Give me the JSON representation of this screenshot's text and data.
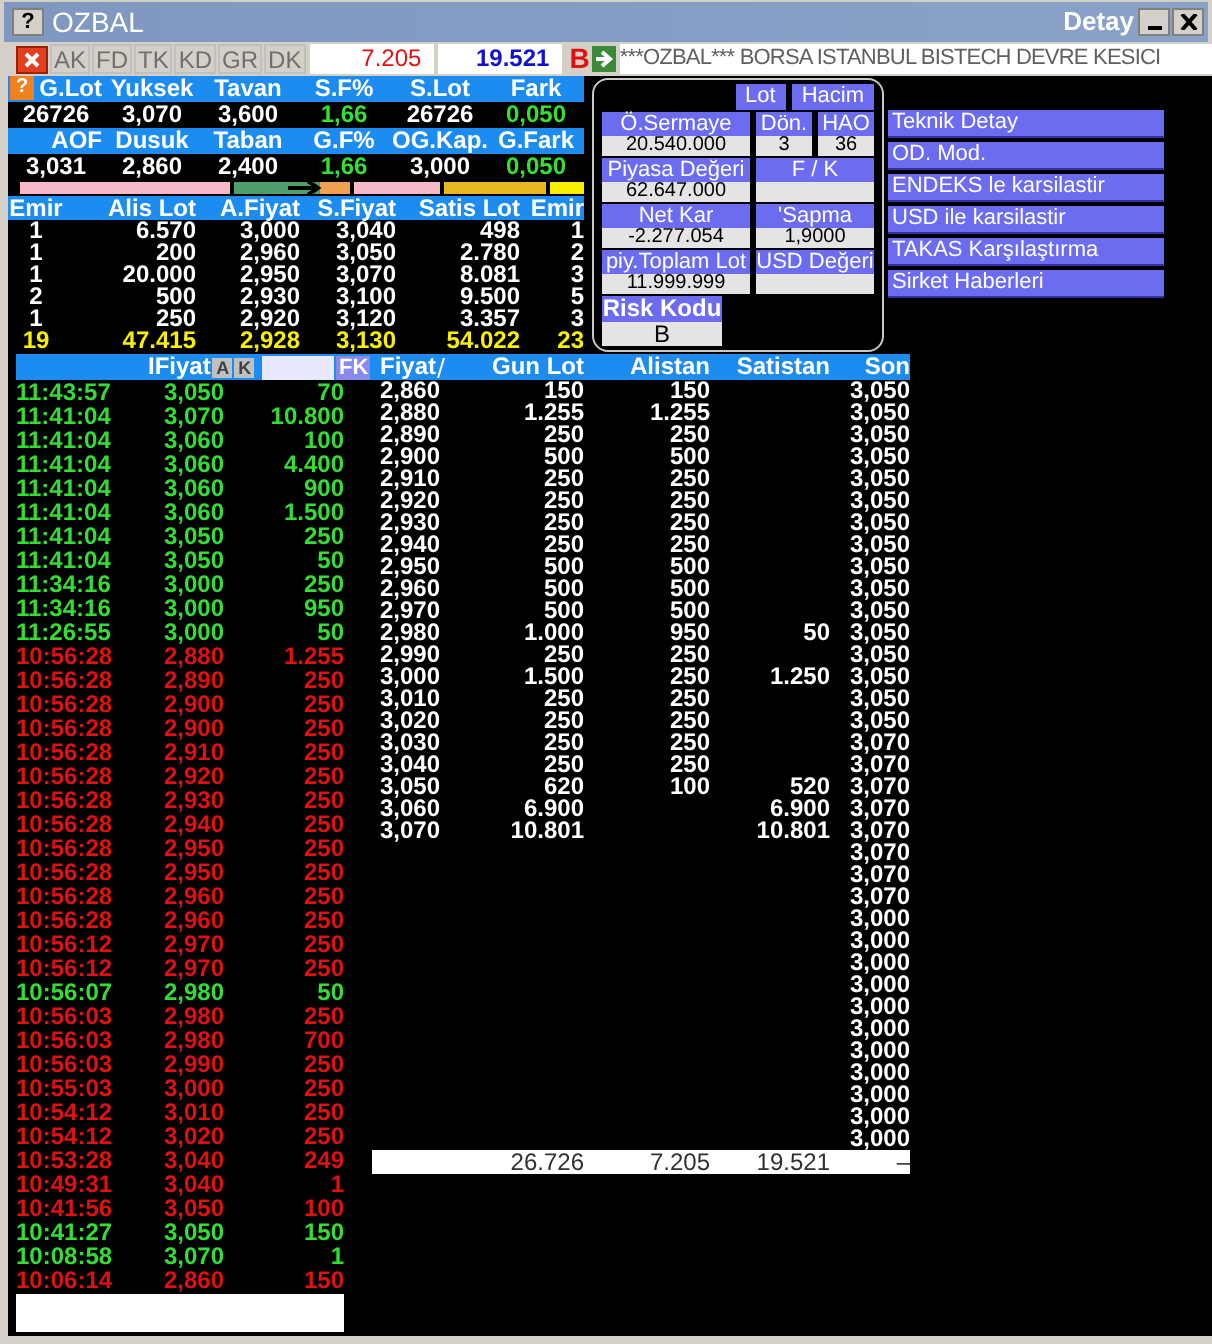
{
  "window": {
    "help": "?",
    "title": "OZBAL",
    "detail_title": "Detay"
  },
  "summary_help": "?",
  "toolbar": {
    "tabs": [
      {
        "label": "AK",
        "disabled": true
      },
      {
        "label": "FD",
        "disabled": true
      },
      {
        "label": "TK",
        "disabled": true
      },
      {
        "label": "KD",
        "disabled": true
      },
      {
        "label": "GR",
        "disabled": true
      },
      {
        "label": "DK",
        "disabled": true
      }
    ],
    "buy_total": "7.205",
    "sell_total": "19.521",
    "side_flag": "B",
    "ticker": "***OZBAL*** BORSA ISTANBUL BISTECH DEVRE KESICI"
  },
  "summary": [
    [
      {
        "label": "G.Lot",
        "value": "26726",
        "up": false
      },
      {
        "label": "Yuksek",
        "value": "3,070",
        "up": false
      },
      {
        "label": "Tavan",
        "value": "3,600",
        "up": false
      },
      {
        "label": "S.F%",
        "value": "1,66",
        "up": true
      },
      {
        "label": "S.Lot",
        "value": "26726",
        "up": false
      },
      {
        "label": "Fark",
        "value": "0,050",
        "up": true
      }
    ],
    [
      {
        "label": "AOF",
        "value": "3,031",
        "up": false
      },
      {
        "label": "Dusuk",
        "value": "2,860",
        "up": false
      },
      {
        "label": "Taban",
        "value": "2,400",
        "up": false
      },
      {
        "label": "G.F%",
        "value": "1,66",
        "up": true
      },
      {
        "label": "OG.Kap.",
        "value": "3,000",
        "up": false
      },
      {
        "label": "G.Fark",
        "value": "0,050",
        "up": true
      }
    ]
  ],
  "order_book": {
    "columns": [
      "Emir",
      "Alis Lot",
      "A.Fiyat",
      "S.Fiyat",
      "Satis Lot",
      "Emir"
    ],
    "rows": [
      [
        "1",
        "6.570",
        "3,000",
        "3,040",
        "498",
        "1"
      ],
      [
        "1",
        "200",
        "2,960",
        "3,050",
        "2.780",
        "2"
      ],
      [
        "1",
        "20.000",
        "2,950",
        "3,070",
        "8.081",
        "3"
      ],
      [
        "2",
        "500",
        "2,930",
        "3,100",
        "9.500",
        "5"
      ],
      [
        "1",
        "250",
        "2,920",
        "3,120",
        "3.357",
        "3"
      ]
    ],
    "totals": [
      "19",
      "47.415",
      "2,928",
      "3,130",
      "54.022",
      "23"
    ]
  },
  "fundamentals": {
    "unit_buttons": [
      "Lot",
      "Hacim"
    ],
    "fields": [
      [
        {
          "label": "Ö.Sermaye",
          "value": "20.540.000"
        },
        {
          "label": "Dön.",
          "value": "3"
        },
        {
          "label": "HAO",
          "value": "36"
        }
      ],
      [
        {
          "label": "Piyasa Değeri",
          "value": "62.647.000"
        },
        {
          "label": "F / K"
        }
      ],
      [
        {
          "label": "Net Kar",
          "value": "-2.277.054"
        },
        {
          "label": "'Sapma",
          "value": "1,9000"
        }
      ],
      [
        {
          "label": "piy.Toplam Lot",
          "value": "11.999.999"
        },
        {
          "label": "USD Değeri"
        }
      ]
    ],
    "risk": {
      "label": "Risk Kodu",
      "value": "B"
    }
  },
  "actions": [
    "Teknik Detay",
    "OD. Mod.",
    "ENDEKS le karsilastir",
    "USD ile karsilastir",
    "TAKAS Karşılaştırma",
    "Sirket Haberleri"
  ],
  "trades": {
    "price_label": "IFiyat",
    "sort_buttons": [
      "A",
      "K"
    ],
    "filter_button": "FK",
    "rows": [
      {
        "time": "11:43:57",
        "price": "3,050",
        "lot": "70",
        "kind": "up"
      },
      {
        "time": "11:41:04",
        "price": "3,070",
        "lot": "10.800",
        "kind": "up"
      },
      {
        "time": "11:41:04",
        "price": "3,060",
        "lot": "100",
        "kind": "up"
      },
      {
        "time": "11:41:04",
        "price": "3,060",
        "lot": "4.400",
        "kind": "up"
      },
      {
        "time": "11:41:04",
        "price": "3,060",
        "lot": "900",
        "kind": "up"
      },
      {
        "time": "11:41:04",
        "price": "3,060",
        "lot": "1.500",
        "kind": "up"
      },
      {
        "time": "11:41:04",
        "price": "3,050",
        "lot": "250",
        "kind": "up"
      },
      {
        "time": "11:41:04",
        "price": "3,050",
        "lot": "50",
        "kind": "up"
      },
      {
        "time": "11:34:16",
        "price": "3,000",
        "lot": "250",
        "kind": "up"
      },
      {
        "time": "11:34:16",
        "price": "3,000",
        "lot": "950",
        "kind": "up"
      },
      {
        "time": "11:26:55",
        "price": "3,000",
        "lot": "50",
        "kind": "up"
      },
      {
        "time": "10:56:28",
        "price": "2,880",
        "lot": "1.255",
        "kind": "down"
      },
      {
        "time": "10:56:28",
        "price": "2,890",
        "lot": "250",
        "kind": "down"
      },
      {
        "time": "10:56:28",
        "price": "2,900",
        "lot": "250",
        "kind": "down"
      },
      {
        "time": "10:56:28",
        "price": "2,900",
        "lot": "250",
        "kind": "down"
      },
      {
        "time": "10:56:28",
        "price": "2,910",
        "lot": "250",
        "kind": "down"
      },
      {
        "time": "10:56:28",
        "price": "2,920",
        "lot": "250",
        "kind": "down"
      },
      {
        "time": "10:56:28",
        "price": "2,930",
        "lot": "250",
        "kind": "down"
      },
      {
        "time": "10:56:28",
        "price": "2,940",
        "lot": "250",
        "kind": "down"
      },
      {
        "time": "10:56:28",
        "price": "2,950",
        "lot": "250",
        "kind": "down"
      },
      {
        "time": "10:56:28",
        "price": "2,950",
        "lot": "250",
        "kind": "down"
      },
      {
        "time": "10:56:28",
        "price": "2,960",
        "lot": "250",
        "kind": "down"
      },
      {
        "time": "10:56:28",
        "price": "2,960",
        "lot": "250",
        "kind": "down"
      },
      {
        "time": "10:56:12",
        "price": "2,970",
        "lot": "250",
        "kind": "down"
      },
      {
        "time": "10:56:12",
        "price": "2,970",
        "lot": "250",
        "kind": "down"
      },
      {
        "time": "10:56:07",
        "price": "2,980",
        "lot": "50",
        "kind": "up"
      },
      {
        "time": "10:56:03",
        "price": "2,980",
        "lot": "250",
        "kind": "down"
      },
      {
        "time": "10:56:03",
        "price": "2,980",
        "lot": "700",
        "kind": "down"
      },
      {
        "time": "10:56:03",
        "price": "2,990",
        "lot": "250",
        "kind": "down"
      },
      {
        "time": "10:55:03",
        "price": "3,000",
        "lot": "250",
        "kind": "down"
      },
      {
        "time": "10:54:12",
        "price": "3,010",
        "lot": "250",
        "kind": "down"
      },
      {
        "time": "10:54:12",
        "price": "3,020",
        "lot": "250",
        "kind": "down"
      },
      {
        "time": "10:53:28",
        "price": "3,040",
        "lot": "249",
        "kind": "down"
      },
      {
        "time": "10:49:31",
        "price": "3,040",
        "lot": "1",
        "kind": "down"
      },
      {
        "time": "10:41:56",
        "price": "3,050",
        "lot": "100",
        "kind": "down"
      },
      {
        "time": "10:41:27",
        "price": "3,050",
        "lot": "150",
        "kind": "up"
      },
      {
        "time": "10:08:58",
        "price": "3,070",
        "lot": "1",
        "kind": "up"
      },
      {
        "time": "10:06:14",
        "price": "2,860",
        "lot": "150",
        "kind": "down"
      }
    ]
  },
  "price_table": {
    "columns": [
      "Fiyat",
      "Gun Lot",
      "Alistan",
      "Satistan",
      "Son"
    ],
    "rows": [
      {
        "fiyat": "2,860",
        "gun_lot": "150",
        "alistan": "150",
        "son": "3,050"
      },
      {
        "fiyat": "2,880",
        "gun_lot": "1.255",
        "alistan": "1.255",
        "son": "3,050"
      },
      {
        "fiyat": "2,890",
        "gun_lot": "250",
        "alistan": "250",
        "son": "3,050"
      },
      {
        "fiyat": "2,900",
        "gun_lot": "500",
        "alistan": "500",
        "son": "3,050"
      },
      {
        "fiyat": "2,910",
        "gun_lot": "250",
        "alistan": "250",
        "son": "3,050"
      },
      {
        "fiyat": "2,920",
        "gun_lot": "250",
        "alistan": "250",
        "son": "3,050"
      },
      {
        "fiyat": "2,930",
        "gun_lot": "250",
        "alistan": "250",
        "son": "3,050"
      },
      {
        "fiyat": "2,940",
        "gun_lot": "250",
        "alistan": "250",
        "son": "3,050"
      },
      {
        "fiyat": "2,950",
        "gun_lot": "500",
        "alistan": "500",
        "son": "3,050"
      },
      {
        "fiyat": "2,960",
        "gun_lot": "500",
        "alistan": "500",
        "son": "3,050"
      },
      {
        "fiyat": "2,970",
        "gun_lot": "500",
        "alistan": "500",
        "son": "3,050"
      },
      {
        "fiyat": "2,980",
        "gun_lot": "1.000",
        "alistan": "950",
        "satistan": "50",
        "son": "3,050"
      },
      {
        "fiyat": "2,990",
        "gun_lot": "250",
        "alistan": "250",
        "son": "3,050"
      },
      {
        "fiyat": "3,000",
        "gun_lot": "1.500",
        "alistan": "250",
        "satistan": "1.250",
        "son": "3,050"
      },
      {
        "fiyat": "3,010",
        "gun_lot": "250",
        "alistan": "250",
        "son": "3,050"
      },
      {
        "fiyat": "3,020",
        "gun_lot": "250",
        "alistan": "250",
        "son": "3,050"
      },
      {
        "fiyat": "3,030",
        "gun_lot": "250",
        "alistan": "250",
        "son": "3,070"
      },
      {
        "fiyat": "3,040",
        "gun_lot": "250",
        "alistan": "250",
        "son": "3,070"
      },
      {
        "fiyat": "3,050",
        "gun_lot": "620",
        "alistan": "100",
        "satistan": "520",
        "son": "3,070"
      },
      {
        "fiyat": "3,060",
        "gun_lot": "6.900",
        "satistan": "6.900",
        "son": "3,070"
      },
      {
        "fiyat": "3,070",
        "gun_lot": "10.801",
        "satistan": "10.801",
        "son": "3,070"
      },
      {
        "son": "3,070"
      },
      {
        "son": "3,070"
      },
      {
        "son": "3,070"
      },
      {
        "son": "3,000"
      },
      {
        "son": "3,000"
      },
      {
        "son": "3,000"
      },
      {
        "son": "3,000"
      },
      {
        "son": "3,000"
      },
      {
        "son": "3,000"
      },
      {
        "son": "3,000"
      },
      {
        "son": "3,000"
      },
      {
        "son": "3,000"
      },
      {
        "son": "3,000"
      },
      {
        "son": "3,000"
      }
    ],
    "totals": {
      "gun_lot": "26.726",
      "alistan": "7.205",
      "satistan": "19.521",
      "son": "–"
    }
  }
}
